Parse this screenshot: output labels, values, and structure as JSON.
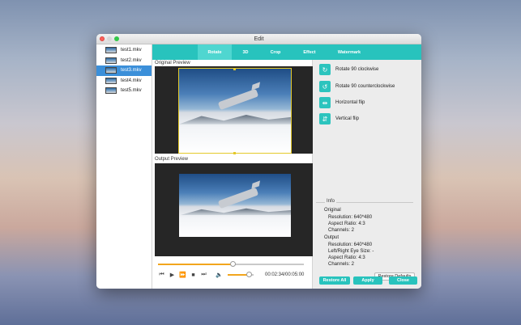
{
  "window": {
    "title": "Edit"
  },
  "files": [
    {
      "name": "test1.mkv",
      "selected": false
    },
    {
      "name": "test2.mkv",
      "selected": false
    },
    {
      "name": "test3.mkv",
      "selected": true
    },
    {
      "name": "test4.mkv",
      "selected": false
    },
    {
      "name": "test5.mkv",
      "selected": false
    }
  ],
  "tabs": [
    {
      "label": "Rotate",
      "active": true
    },
    {
      "label": "3D",
      "active": false
    },
    {
      "label": "Crop",
      "active": false
    },
    {
      "label": "Effect",
      "active": false
    },
    {
      "label": "Watermark",
      "active": false
    }
  ],
  "preview": {
    "original_label": "Original Preview",
    "output_label": "Output Preview"
  },
  "options": [
    {
      "label": "Rotate 90 clockwise",
      "icon": "rotate-clockwise-icon",
      "glyph": "↻"
    },
    {
      "label": "Rotate 90 counterclockwise",
      "icon": "rotate-counterclockwise-icon",
      "glyph": "↺"
    },
    {
      "label": "Horizontal flip",
      "icon": "horizontal-flip-icon",
      "glyph": "⇹"
    },
    {
      "label": "Vertical flip",
      "icon": "vertical-flip-icon",
      "glyph": "⇵"
    }
  ],
  "info": {
    "legend": "Info",
    "original_heading": "Original",
    "original_resolution": "Resolution: 640*480",
    "original_aspect": "Aspect Ratio: 4:3",
    "original_channels": "Channels: 2",
    "output_heading": "Output",
    "output_resolution": "Resolution: 640*480",
    "output_eye_size": "Left/Right Eye Size: -",
    "output_aspect": "Aspect Ratio: 4:3",
    "output_channels": "Channels: 2"
  },
  "player": {
    "timecode": "00:02:34/00:05:00",
    "progress": 0.51,
    "volume": 0.82
  },
  "buttons": {
    "restore_defaults": "Restore Defaults",
    "restore_all": "Restore All",
    "apply": "Apply",
    "close": "Close"
  },
  "colors": {
    "accent": "#28c3bd",
    "selection": "#3b8fd9",
    "progress": "#f2a51d"
  }
}
